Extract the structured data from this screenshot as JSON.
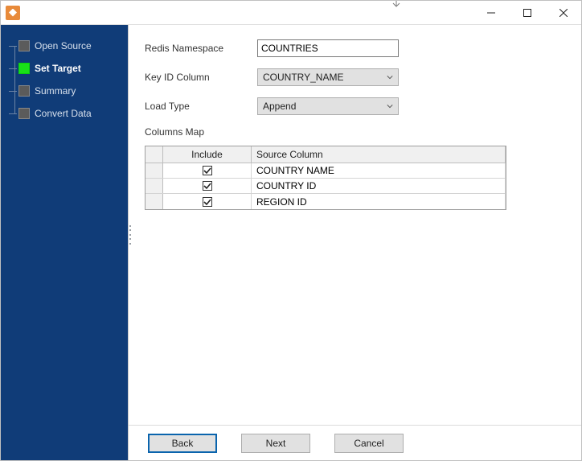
{
  "sidebar": {
    "items": [
      {
        "label": "Open Source",
        "active": false
      },
      {
        "label": "Set Target",
        "active": true
      },
      {
        "label": "Summary",
        "active": false
      },
      {
        "label": "Convert Data",
        "active": false
      }
    ]
  },
  "form": {
    "redis_namespace_label": "Redis Namespace",
    "redis_namespace_value": "COUNTRIES",
    "key_id_label": "Key ID Column",
    "key_id_value": "COUNTRY_NAME",
    "load_type_label": "Load Type",
    "load_type_value": "Append",
    "columns_map_label": "Columns Map"
  },
  "grid": {
    "headers": {
      "include": "Include",
      "source": "Source Column"
    },
    "rows": [
      {
        "include": true,
        "source": "COUNTRY NAME"
      },
      {
        "include": true,
        "source": "COUNTRY ID"
      },
      {
        "include": true,
        "source": "REGION ID"
      }
    ]
  },
  "footer": {
    "back": "Back",
    "next": "Next",
    "cancel": "Cancel"
  }
}
